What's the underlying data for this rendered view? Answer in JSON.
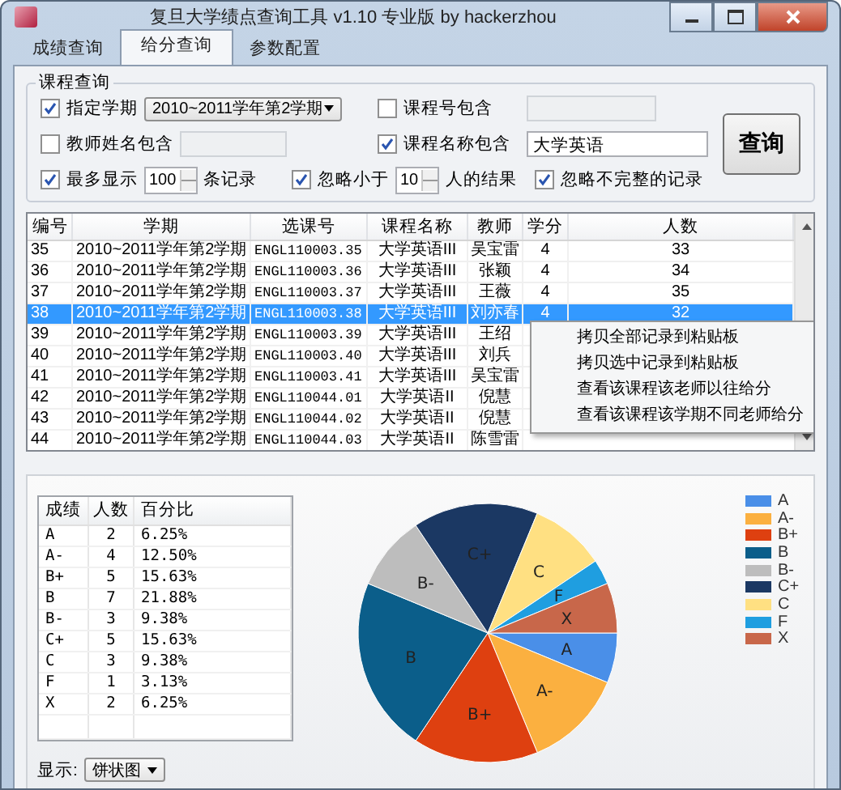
{
  "window": {
    "title": "复旦大学绩点查询工具 v1.10 专业版 by hackerzhou"
  },
  "tabs": [
    {
      "label": "成绩查询",
      "selected": false
    },
    {
      "label": "给分查询",
      "selected": true
    },
    {
      "label": "参数配置",
      "selected": false
    }
  ],
  "course_query": {
    "title": "课程查询",
    "semester": {
      "label": "指定学期",
      "checked": true,
      "value": "2010~2011学年第2学期"
    },
    "course_no": {
      "label": "课程号包含",
      "checked": false
    },
    "teacher": {
      "label": "教师姓名包含",
      "checked": false
    },
    "course_name": {
      "label": "课程名称包含",
      "checked": true,
      "value": "大学英语"
    },
    "max_rows": {
      "label": "最多显示",
      "checked": true,
      "value": "100",
      "suffix": "条记录"
    },
    "min_people": {
      "label": "忽略小于",
      "checked": true,
      "value": "10",
      "suffix": "人的结果"
    },
    "ignore_incomplete": {
      "label": "忽略不完整的记录",
      "checked": true
    },
    "query_button": "查询"
  },
  "table": {
    "columns": [
      "编号",
      "学期",
      "选课号",
      "课程名称",
      "教师",
      "学分",
      "人数"
    ],
    "rows": [
      {
        "cells": [
          "35",
          "2010~2011学年第2学期",
          "ENGL110003.35",
          "大学英语III",
          "吴宝雷",
          "4",
          "33"
        ],
        "selected": false
      },
      {
        "cells": [
          "36",
          "2010~2011学年第2学期",
          "ENGL110003.36",
          "大学英语III",
          "张颖",
          "4",
          "34"
        ],
        "selected": false
      },
      {
        "cells": [
          "37",
          "2010~2011学年第2学期",
          "ENGL110003.37",
          "大学英语III",
          "王薇",
          "4",
          "35"
        ],
        "selected": false
      },
      {
        "cells": [
          "38",
          "2010~2011学年第2学期",
          "ENGL110003.38",
          "大学英语III",
          "刘亦春",
          "4",
          "32"
        ],
        "selected": true
      },
      {
        "cells": [
          "39",
          "2010~2011学年第2学期",
          "ENGL110003.39",
          "大学英语III",
          "王绍"
        ],
        "selected": false
      },
      {
        "cells": [
          "40",
          "2010~2011学年第2学期",
          "ENGL110003.40",
          "大学英语III",
          "刘兵"
        ],
        "selected": false
      },
      {
        "cells": [
          "41",
          "2010~2011学年第2学期",
          "ENGL110003.41",
          "大学英语III",
          "吴宝雷"
        ],
        "selected": false
      },
      {
        "cells": [
          "42",
          "2010~2011学年第2学期",
          "ENGL110044.01",
          "大学英语II",
          "倪慧"
        ],
        "selected": false
      },
      {
        "cells": [
          "43",
          "2010~2011学年第2学期",
          "ENGL110044.02",
          "大学英语II",
          "倪慧"
        ],
        "selected": false
      },
      {
        "cells": [
          "44",
          "2010~2011学年第2学期",
          "ENGL110044.03",
          "大学英语II",
          "陈雪雷"
        ],
        "selected": false
      }
    ]
  },
  "context_menu": [
    "拷贝全部记录到粘贴板",
    "拷贝选中记录到粘贴板",
    "查看该课程该老师以往给分",
    "查看该课程该学期不同老师给分"
  ],
  "grade_table": {
    "columns": [
      "成绩",
      "人数",
      "百分比"
    ],
    "rows": [
      [
        "A",
        "2",
        "6.25%"
      ],
      [
        "A-",
        "4",
        "12.50%"
      ],
      [
        "B+",
        "5",
        "15.63%"
      ],
      [
        "B",
        "7",
        "21.88%"
      ],
      [
        "B-",
        "3",
        "9.38%"
      ],
      [
        "C+",
        "5",
        "15.63%"
      ],
      [
        "C",
        "3",
        "9.38%"
      ],
      [
        "F",
        "1",
        "3.13%"
      ],
      [
        "X",
        "2",
        "6.25%"
      ]
    ]
  },
  "display": {
    "label": "显示:",
    "value": "饼状图"
  },
  "chart_data": {
    "type": "pie",
    "categories": [
      "A",
      "A-",
      "B+",
      "B",
      "B-",
      "C+",
      "C",
      "F",
      "X"
    ],
    "values": [
      6.25,
      12.5,
      15.63,
      21.88,
      9.38,
      15.63,
      9.38,
      3.13,
      6.25
    ],
    "legend": "right",
    "colors": [
      "#4a8fe8",
      "#fbb040",
      "#de4010",
      "#0b5e8a",
      "#bdbdbd",
      "#1b3863",
      "#ffe082",
      "#1f9ee0",
      "#c8674a"
    ]
  }
}
